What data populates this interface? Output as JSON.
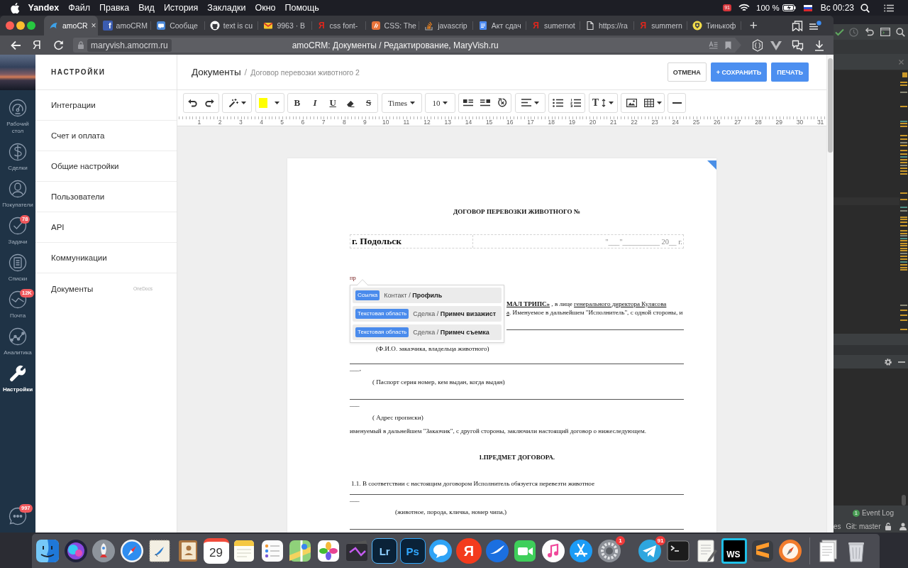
{
  "menubar": {
    "app": "Yandex",
    "menus": [
      "Файл",
      "Правка",
      "Вид",
      "История",
      "Закладки",
      "Окно",
      "Помощь"
    ],
    "status_badge": "91",
    "battery": "100 %",
    "clock": "Вс 00:23"
  },
  "browser": {
    "tabs": [
      {
        "title": "amoCR",
        "selected": true,
        "close": "×"
      },
      {
        "title": "amoCRM",
        "selected": false,
        "favicon_text": "f"
      },
      {
        "title": "Сообще",
        "selected": false
      },
      {
        "title": "text is cu",
        "selected": false
      },
      {
        "title": "9963 · В",
        "selected": false
      },
      {
        "title": "css font-",
        "selected": false,
        "favicon_text": "Я"
      },
      {
        "title": "CSS: The",
        "selected": false
      },
      {
        "title": "javascrip",
        "selected": false
      },
      {
        "title": "Акт сдач",
        "selected": false
      },
      {
        "title": "sumernot",
        "selected": false,
        "favicon_text": "Я"
      },
      {
        "title": "https://ra",
        "selected": false
      },
      {
        "title": "summern",
        "selected": false,
        "favicon_text": "Я"
      },
      {
        "title": "Тинькоф",
        "selected": false
      }
    ],
    "new_tab": "+",
    "home": "Я",
    "url": "maryvish.amocrm.ru",
    "page_title": "amoCRM: Документы / Редактирование, MaryVish.ru"
  },
  "app": {
    "nav": [
      {
        "label": "Рабочий стол",
        "selected": false
      },
      {
        "label": "Сделки",
        "selected": false
      },
      {
        "label": "Покупатели",
        "selected": false
      },
      {
        "label": "Задачи",
        "selected": false,
        "badge": "78"
      },
      {
        "label": "Списки",
        "selected": false
      },
      {
        "label": "Почта",
        "selected": false,
        "badge": "12K"
      },
      {
        "label": "Аналитика",
        "selected": false
      },
      {
        "label": "Настройки",
        "selected": true
      }
    ],
    "chat_badge": "997",
    "settings": {
      "title": "НАСТРОЙКИ",
      "items": [
        {
          "label": "Интеграции"
        },
        {
          "label": "Счет и оплата"
        },
        {
          "label": "Общие настройки"
        },
        {
          "label": "Пользователи"
        },
        {
          "label": "API"
        },
        {
          "label": "Коммуникации"
        },
        {
          "label": "Документы",
          "note": "OneDocs"
        }
      ]
    },
    "header": {
      "section": "Документы",
      "separator": "/",
      "document": "Договор перевозки животного 2",
      "buttons": [
        {
          "label": "ОТМЕНА",
          "kind": "secondary"
        },
        {
          "label": "+ СОХРАНИТЬ",
          "kind": "primary"
        },
        {
          "label": "ПЕЧАТЬ",
          "kind": "primary"
        }
      ]
    },
    "toolbar": {
      "style_letters": [
        "B",
        "I",
        "U"
      ],
      "strike_letter": "S",
      "font": "Times",
      "size": "10",
      "text_height_letter": "T"
    },
    "ruler": [
      "1",
      "2",
      "3",
      "4",
      "5",
      "6",
      "7",
      "8",
      "9",
      "10",
      "11",
      "12",
      "13",
      "14",
      "15",
      "16",
      "17",
      "18",
      "19",
      "20",
      "21",
      "22",
      "23",
      "24",
      "25",
      "26",
      "27",
      "28",
      "29",
      "30",
      "31"
    ],
    "document": {
      "blocks": [
        {
          "kind": "title",
          "text": "ДОГОВОР ПЕРЕВОЗКИ ЖИВОТНОГО №"
        },
        {
          "kind": "place_date",
          "left": "г. Подольск",
          "right": "\"___\"__________ 20__ г."
        },
        {
          "kind": "typed",
          "text": "пр"
        },
        {
          "kind": "paragraph",
          "lines": [
            [
              {
                "text": "МАЛ ТРИПС»",
                "bold": true,
                "underline": true
              },
              {
                "text": " , в лице ",
                "bold": false,
                "underline": false
              },
              {
                "text": "генерального директора Кулясова",
                "bold": false,
                "underline": true
              }
            ],
            [
              {
                "text": "а",
                "bold": false,
                "underline": true
              },
              {
                "text": ". Именуемое в дальнейшем \"Исполнитель\", с одной стороны, и",
                "bold": false,
                "underline": false
              }
            ]
          ]
        },
        {
          "kind": "blank"
        },
        {
          "kind": "caption",
          "text": "(Ф.И.О. заказчика, владельца животного)"
        },
        {
          "kind": "blank"
        },
        {
          "kind": "underscore",
          "text": "___,"
        },
        {
          "kind": "caption",
          "text": "( Паспорт серия номер, кем выдан, когда выдан)"
        },
        {
          "kind": "blank"
        },
        {
          "kind": "underscore",
          "text": "___"
        },
        {
          "kind": "caption",
          "text": "( Адрес прописки)"
        },
        {
          "kind": "text",
          "text": "именуемый в дальнейшем \"Заказчик\", с другой стороны, заключили настоящий договор о нижеследующем."
        },
        {
          "kind": "heading",
          "text": "1.ПРЕДМЕТ ДОГОВОРА."
        },
        {
          "kind": "text",
          "text": "1.1. В соответствии с настоящим договором Исполнитель обязуется перевезти животное"
        },
        {
          "kind": "blank"
        },
        {
          "kind": "underscore",
          "text": "___"
        },
        {
          "kind": "caption",
          "text": "(животное, порода, кличка, номер чипа,)"
        },
        {
          "kind": "blank"
        }
      ]
    },
    "suggestions": [
      {
        "tag": "Ссылка",
        "text": "Контакт / **Профиль**"
      },
      {
        "tag": "Текстовая область",
        "text": "Сделка / **Примеч визажист**"
      },
      {
        "tag": "Текстовая область",
        "text": "Сделка / **Примеч съемка**"
      }
    ]
  },
  "ide": {
    "event_badge": "1",
    "event_log": "Event Log",
    "clipped": "es",
    "branch": "Git: master"
  },
  "dock": {
    "calendar_day": "29",
    "letter_tiles": [
      "Lr",
      "Ps"
    ],
    "round_letter": "Я",
    "prefs_badge": "1",
    "messenger_badge": "91",
    "ws_tile": "WS"
  }
}
